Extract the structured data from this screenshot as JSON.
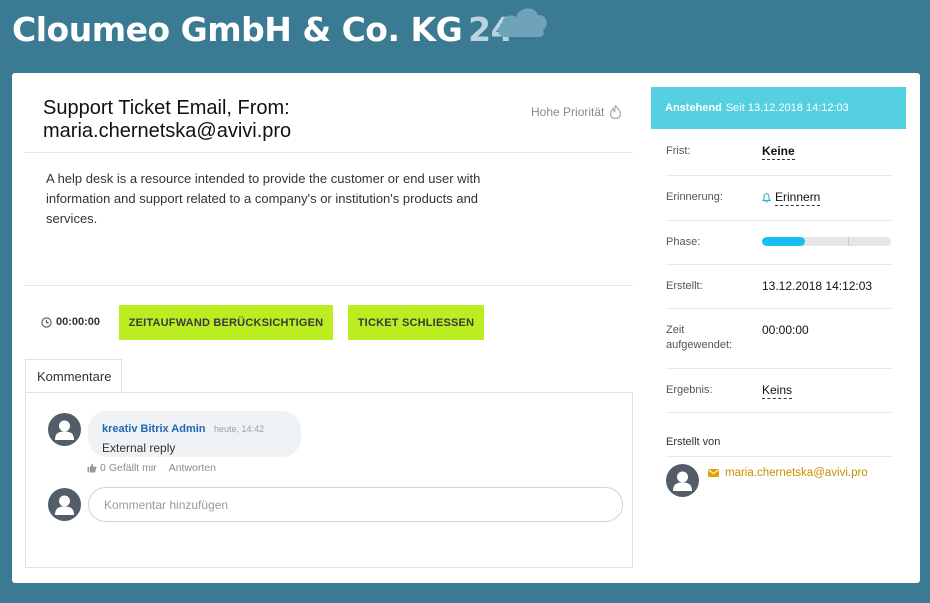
{
  "header": {
    "brand_name": "Cloumeo GmbH & Co. KG",
    "brand_number": "24"
  },
  "ticket": {
    "title": "Support Ticket Email, From: maria.chernetska@avivi.pro",
    "priority": "Hohe Priorität",
    "description": "A help desk is a resource intended to provide the customer or end user with information and support related to a company's or institution's products and services.",
    "timer": "00:00:00",
    "btn_time": "ZEITAUFWAND BERÜCKSICHTIGEN",
    "btn_close": "TICKET SCHLIESSEN"
  },
  "comments": {
    "tab_label": "Kommentare",
    "items": [
      {
        "author": "kreativ Bitrix Admin",
        "time": "heute, 14:42",
        "text": "External reply",
        "likes": "0",
        "like_label": "Gefällt mir",
        "reply_label": "Antworten"
      }
    ],
    "input_placeholder": "Kommentar hinzufügen"
  },
  "sidebar": {
    "status": "Anstehend",
    "status_since": "Seit 13.12.2018 14:12:03",
    "deadline_label": "Frist:",
    "deadline_value": "Keine",
    "reminder_label": "Erinnerung:",
    "reminder_value": "Erinnern",
    "phase_label": "Phase:",
    "phase_progress": 0.33,
    "created_label": "Erstellt:",
    "created_value": "13.12.2018 14:12:03",
    "time_spent_label": "Zeit aufgewendet:",
    "time_spent_value": "00:00:00",
    "result_label": "Ergebnis:",
    "result_value": "Keins",
    "created_by_label": "Erstellt von",
    "created_by_email": "maria.chernetska@avivi.pro"
  },
  "colors": {
    "background": "#3b7a93",
    "lime_button": "#bbed21",
    "status_bar": "#55d0e0",
    "progress_fill": "#16c0f2",
    "author_link": "#2067b0",
    "email_link": "#c89000"
  },
  "icons": [
    "cloud-icon",
    "flame-icon",
    "clock-icon",
    "thumb-up-icon",
    "bell-icon",
    "envelope-icon",
    "user-avatar-icon"
  ]
}
